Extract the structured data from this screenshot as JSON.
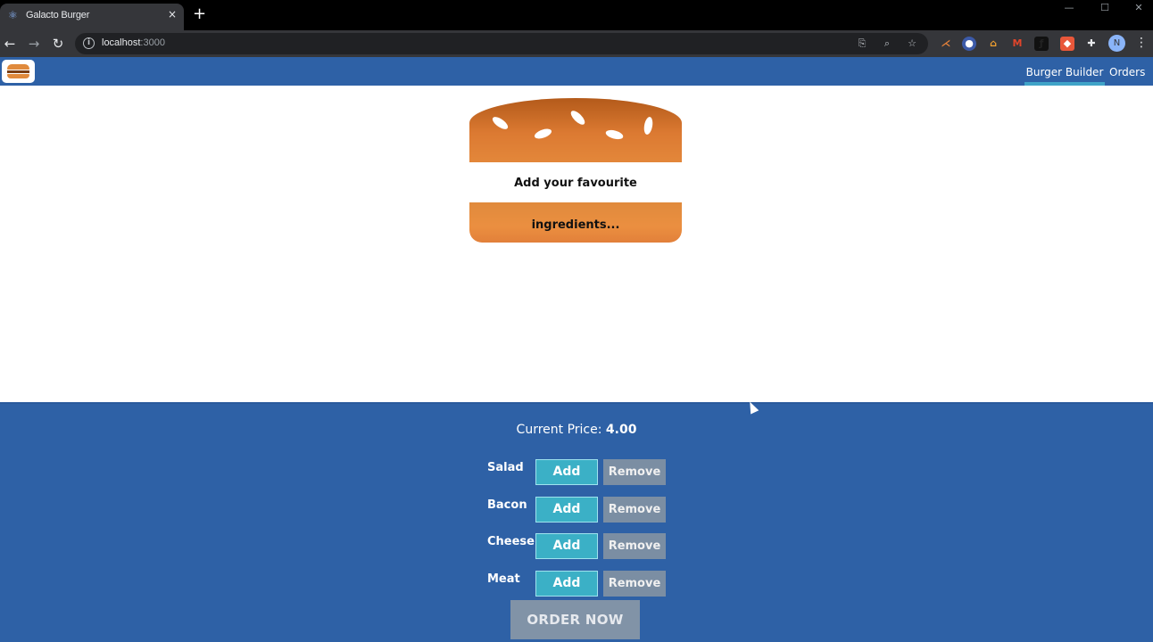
{
  "browser": {
    "tab_title": "Galacto Burger",
    "tab_close": "×",
    "new_tab": "+",
    "url_host": "localhost",
    "url_port": ":3000",
    "window_controls": [
      "—",
      "☐",
      "✕"
    ]
  },
  "nav": {
    "items": [
      {
        "label": "Burger Builder",
        "active": true
      },
      {
        "label": "Orders",
        "active": false
      }
    ]
  },
  "burger": {
    "empty_message": "Add your favourite ingredients..."
  },
  "controls": {
    "price_label": "Current Price:",
    "price_value": "4.00",
    "ingredients": [
      {
        "label": "Salad",
        "add": "Add",
        "remove": "Remove"
      },
      {
        "label": "Bacon",
        "add": "Add",
        "remove": "Remove"
      },
      {
        "label": "Cheese",
        "add": "Add",
        "remove": "Remove"
      },
      {
        "label": "Meat",
        "add": "Add",
        "remove": "Remove"
      }
    ],
    "order_button": "ORDER NOW"
  },
  "colors": {
    "app_blue": "#2e61a6",
    "add_button": "#3bb0c6",
    "remove_button": "#7b8ea3",
    "order_button": "#8193a7",
    "bread": "#e08a3c"
  }
}
